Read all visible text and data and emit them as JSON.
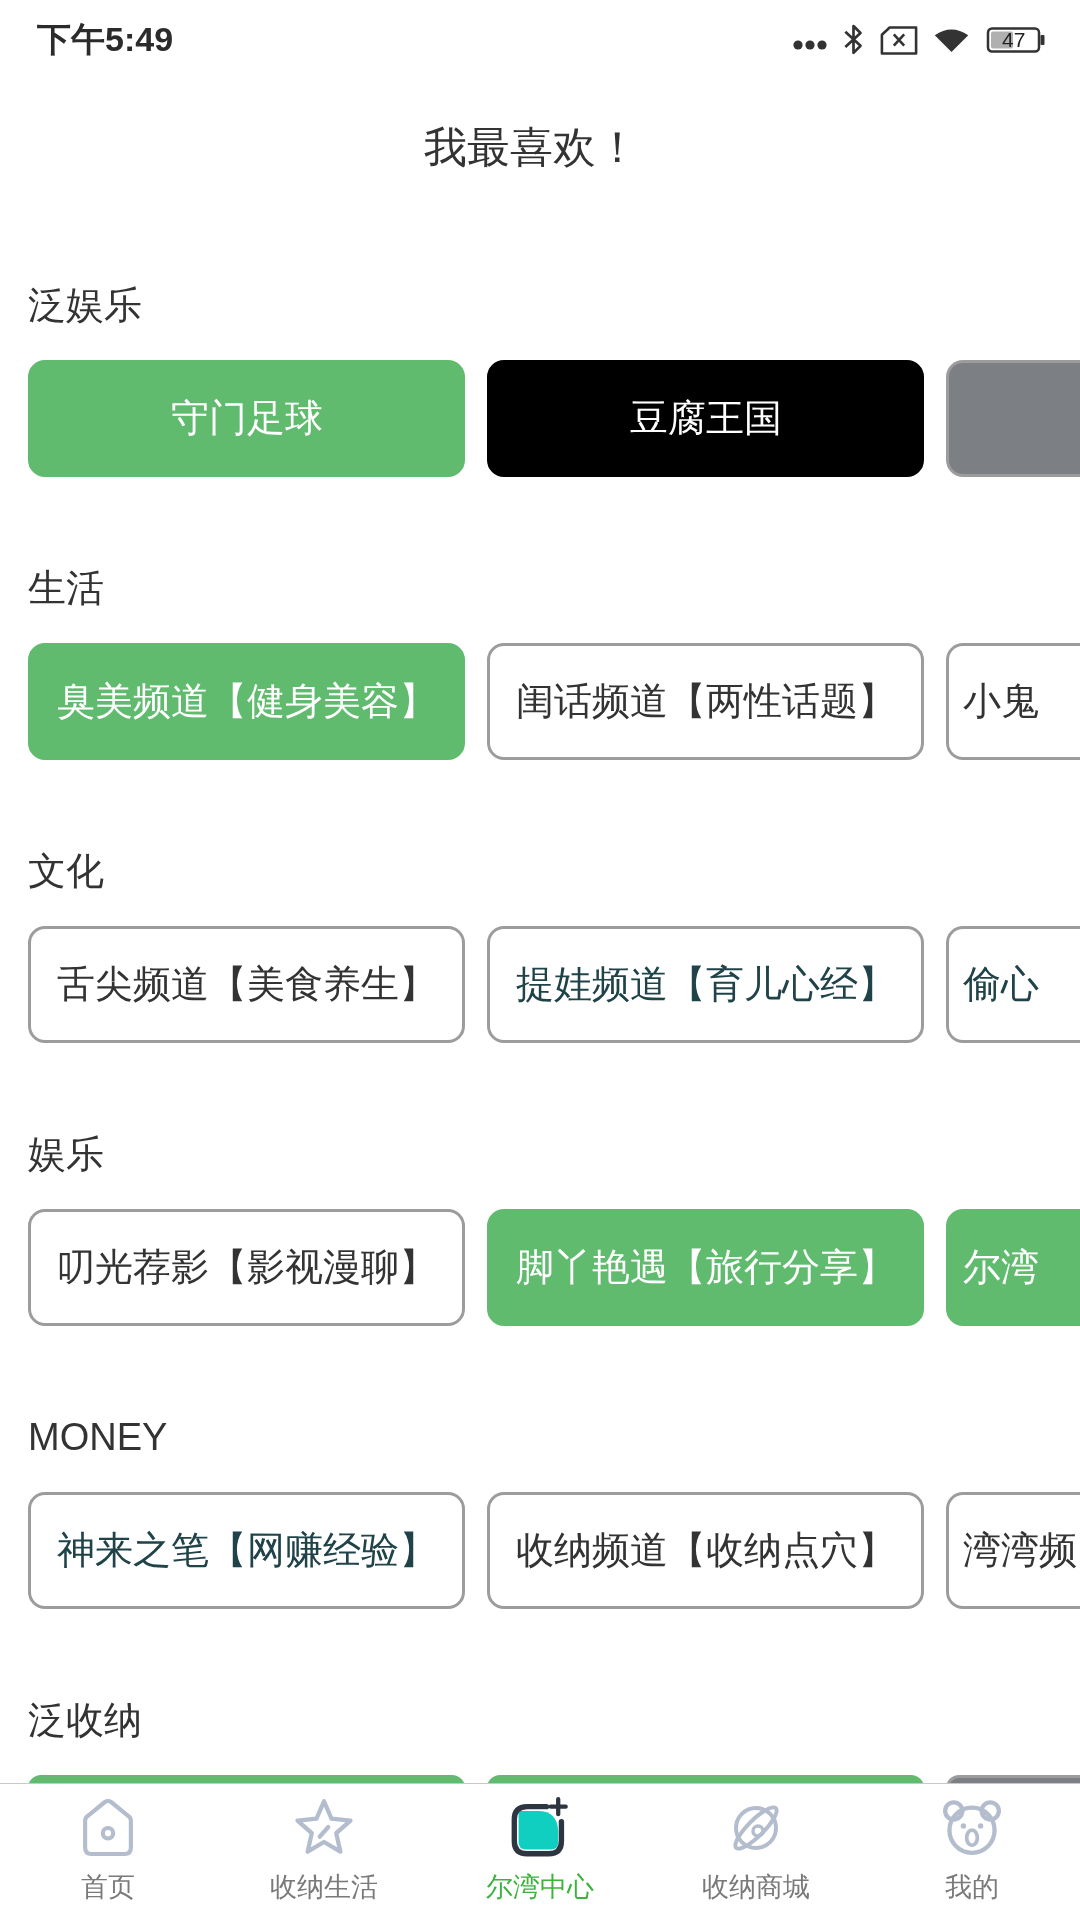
{
  "status_bar": {
    "time": "下午5:49",
    "battery": "47"
  },
  "title": "我最喜欢！",
  "sections": [
    {
      "label": "泛娱乐",
      "cards": [
        {
          "label": {
            "text": "守门足球"
          },
          "color": "#61bb6f",
          "outlined": false
        },
        {
          "label": {
            "text": "豆腐王国"
          },
          "color": "#000000",
          "outlined": false
        },
        {
          "color": "#7c7f84",
          "outlined": true
        }
      ]
    },
    {
      "label": "生活",
      "cards": [
        {
          "label": {
            "text": "臭美频道【健身美容】"
          },
          "color": "#61bb6f",
          "outlined": false
        },
        {
          "label": {
            "text": "闺话频道【两性话题】",
            "color": "#333333"
          },
          "color": "#ffffff",
          "outlined": true
        },
        {
          "label": {
            "text": "小鬼",
            "color": "#333333"
          },
          "color": "#ffffff",
          "outlined": true
        }
      ]
    },
    {
      "label": "文化",
      "cards": [
        {
          "label": {
            "text": "舌尖频道【美食养生】",
            "color": "#333333"
          },
          "color": "#ffffff",
          "outlined": true
        },
        {
          "label": {
            "text": "提娃频道【育儿心经】",
            "color": "#1f4349"
          },
          "color": "#ffffff",
          "outlined": true
        },
        {
          "label": {
            "text": "偷心",
            "color": "#1f4349"
          },
          "color": "#ffffff",
          "outlined": true
        }
      ]
    },
    {
      "label": "娱乐",
      "cards": [
        {
          "label": {
            "text": "叨光荐影【影视漫聊】",
            "color": "#333333"
          },
          "color": "#ffffff",
          "outlined": true
        },
        {
          "label": {
            "text": "脚丫艳遇【旅行分享】"
          },
          "color": "#61bb6f",
          "outlined": false
        },
        {
          "label": {
            "text": "尔湾"
          },
          "color": "#61bb6f",
          "outlined": false
        }
      ]
    },
    {
      "label": "MONEY",
      "cards": [
        {
          "label": {
            "text": "神来之笔【网赚经验】",
            "color": "#1f4349"
          },
          "color": "#ffffff",
          "outlined": true
        },
        {
          "label": {
            "text": "收纳频道【收纳点穴】",
            "color": "#333333"
          },
          "color": "#ffffff",
          "outlined": true
        },
        {
          "label": {
            "text": "湾湾频",
            "color": "#333333"
          },
          "color": "#ffffff",
          "outlined": true
        }
      ]
    },
    {
      "label": "泛收纳",
      "cards": [
        {
          "color": "#61bb6f",
          "outlined": false
        },
        {
          "color": "#61bb6f",
          "outlined": false
        },
        {
          "color": "#7c7f84",
          "outlined": true
        }
      ]
    }
  ],
  "tab_bar": [
    {
      "label": "首页",
      "selected": false
    },
    {
      "label": "收纳生活",
      "selected": false
    },
    {
      "label": "尔湾中心",
      "selected": true
    },
    {
      "label": "收纳商城",
      "selected": false
    },
    {
      "label": "我的",
      "selected": false
    }
  ]
}
